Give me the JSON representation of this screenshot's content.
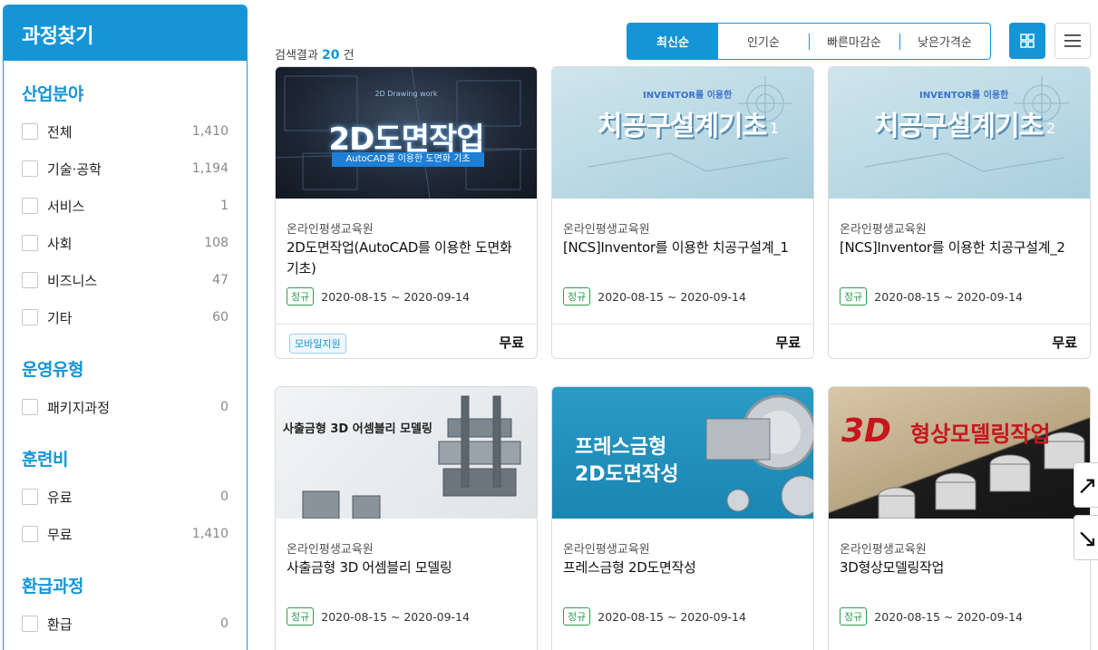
{
  "sidebar": {
    "title": "과정찾기",
    "sections": [
      {
        "title": "산업분야",
        "items": [
          {
            "label": "전체",
            "count": "1,410"
          },
          {
            "label": "기술·공학",
            "count": "1,194"
          },
          {
            "label": "서비스",
            "count": "1"
          },
          {
            "label": "사회",
            "count": "108"
          },
          {
            "label": "비즈니스",
            "count": "47"
          },
          {
            "label": "기타",
            "count": "60"
          }
        ]
      },
      {
        "title": "운영유형",
        "items": [
          {
            "label": "패키지과정",
            "count": "0"
          }
        ]
      },
      {
        "title": "훈련비",
        "items": [
          {
            "label": "유료",
            "count": "0"
          },
          {
            "label": "무료",
            "count": "1,410"
          }
        ]
      },
      {
        "title": "환급과정",
        "items": [
          {
            "label": "환급",
            "count": "0"
          }
        ]
      }
    ]
  },
  "results": {
    "prefix": "검색결과",
    "count": "20",
    "suffix": "건"
  },
  "sort_tabs": [
    "최신순",
    "인기순",
    "빠른마감순",
    "낮은가격순"
  ],
  "colors": {
    "accent": "#1595d6",
    "regular_badge": "#2e9e4f"
  },
  "icons": {
    "grid_view": "grid-icon",
    "list_view": "list-icon"
  },
  "cards": [
    {
      "thumb_title": "2D도면작업",
      "thumb_small": "2D Drawing work",
      "thumb_sub": "AutoCAD를 이용한 도면화 기초",
      "provider": "온라인평생교육원",
      "title": "2D도면작업(AutoCAD를 이용한 도면화 기초)",
      "badge": "정규",
      "date": "2020-08-15 ~ 2020-09-14",
      "mobile": "모바일지원",
      "price": "무료"
    },
    {
      "thumb_small": "INVENTOR를 이용한",
      "thumb_title": "치공구설계기초",
      "thumb_num": "1",
      "provider": "온라인평생교육원",
      "title": "[NCS]Inventor를 이용한 치공구설계_1",
      "badge": "정규",
      "date": "2020-08-15 ~ 2020-09-14",
      "price": "무료"
    },
    {
      "thumb_small": "INVENTOR를 이용한",
      "thumb_title": "치공구설계기초",
      "thumb_num": "2",
      "provider": "온라인평생교육원",
      "title": "[NCS]Inventor를 이용한 치공구설계_2",
      "badge": "정규",
      "date": "2020-08-15 ~ 2020-09-14",
      "price": "무료"
    },
    {
      "thumb_title": "사출금형 3D 어셈블리 모델링",
      "provider": "온라인평생교육원",
      "title": "사출금형 3D 어셈블리 모델링",
      "badge": "정규",
      "date": "2020-08-15 ~ 2020-09-14"
    },
    {
      "thumb_line1": "프레스금형",
      "thumb_line2": "2D도면작성",
      "provider": "온라인평생교육원",
      "title": "프레스금형 2D도면작성",
      "badge": "정규",
      "date": "2020-08-15 ~ 2020-09-14"
    },
    {
      "thumb_3d": "3D",
      "thumb_title": "형상모델링작업",
      "provider": "온라인평생교육원",
      "title": "3D형상모델링작업",
      "badge": "정규",
      "date": "2020-08-15 ~ 2020-09-14"
    }
  ]
}
